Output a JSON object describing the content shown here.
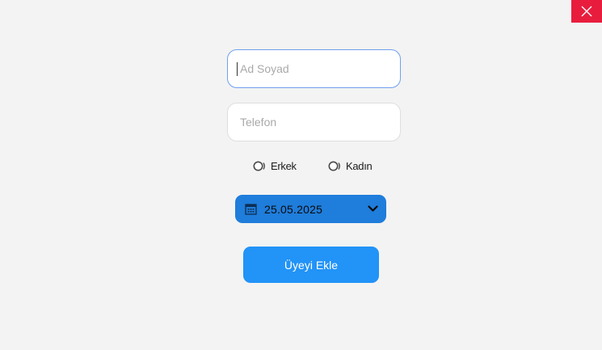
{
  "window": {
    "close_icon": "close-icon",
    "close_color": "#e81d3e"
  },
  "form": {
    "name_placeholder": "Ad Soyad",
    "name_value": "",
    "phone_placeholder": "Telefon",
    "phone_value": "",
    "gender": {
      "male_label": "Erkek",
      "female_label": "Kadın",
      "selected": null
    },
    "date": {
      "value": "25.05.2025",
      "icon": "calendar-icon",
      "dropdown_icon": "chevron-down-icon"
    },
    "submit_label": "Üyeyi Ekle"
  },
  "colors": {
    "background": "#f3f3f3",
    "focus_border": "#6f9ff0",
    "date_picker": "#1f7ddb",
    "primary_button": "#2293f7"
  }
}
